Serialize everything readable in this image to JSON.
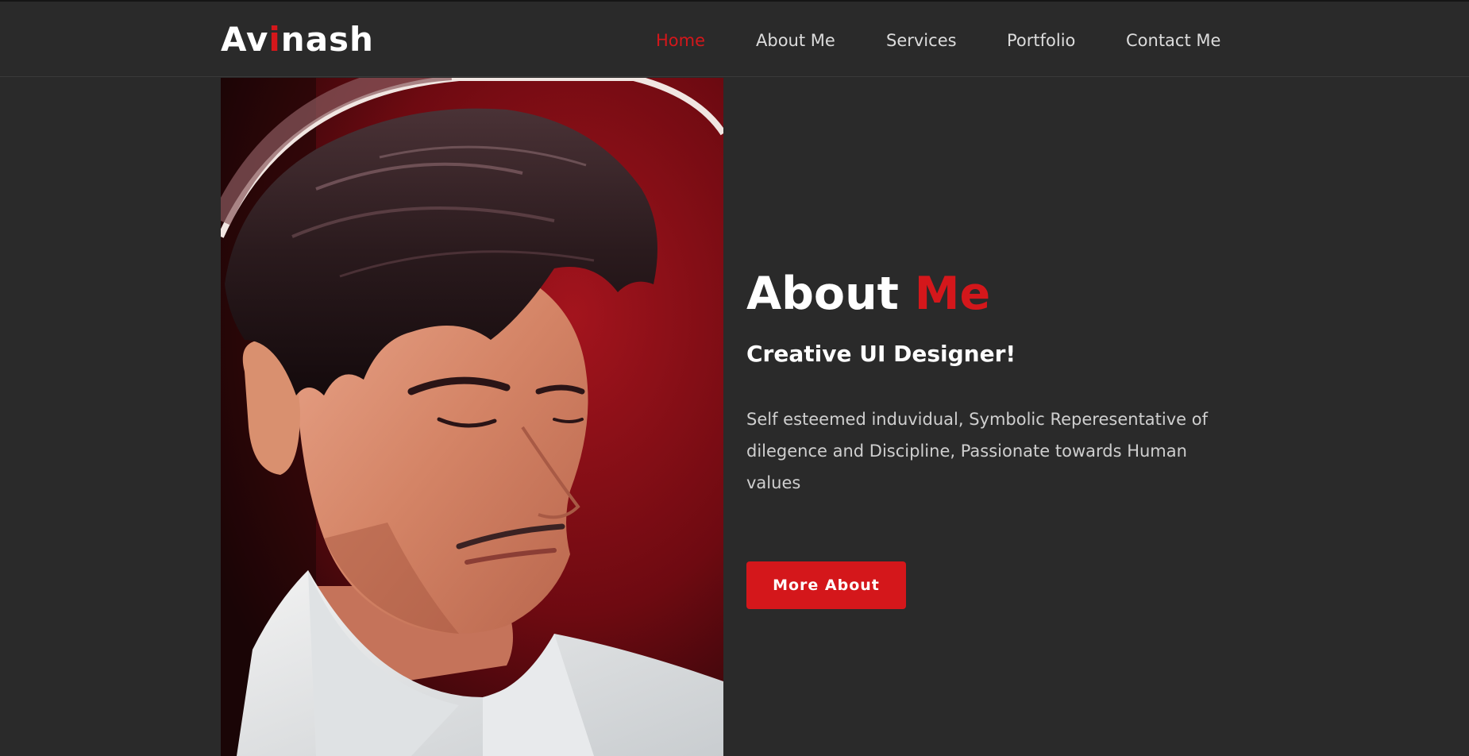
{
  "header": {
    "logo": {
      "part1": "Av",
      "accent": "i",
      "part2": "nash"
    },
    "nav": [
      {
        "label": "Home",
        "active": true
      },
      {
        "label": "About Me",
        "active": false
      },
      {
        "label": "Services",
        "active": false
      },
      {
        "label": "Portfolio",
        "active": false
      },
      {
        "label": "Contact Me",
        "active": false
      }
    ]
  },
  "about": {
    "title_main": "About ",
    "title_accent": "Me",
    "subtitle": "Creative UI Designer!",
    "description": "Self esteemed induvidual, Symbolic Reperesentative of dilegence and Discipline, Passionate towards Human values",
    "button_label": "More About"
  },
  "colors": {
    "background": "#2a2a2a",
    "accent": "#d4171b",
    "text": "#ffffff",
    "muted_text": "#cfcfcf"
  }
}
